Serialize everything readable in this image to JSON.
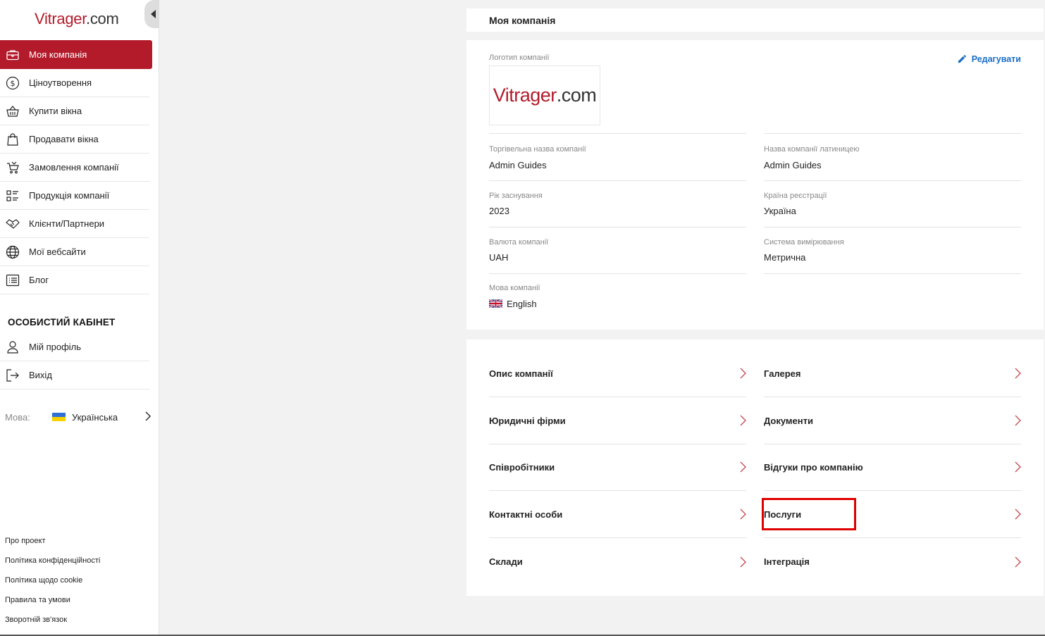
{
  "sidebar": {
    "logo": {
      "brand": "Vitrager",
      "domain": ".com"
    },
    "nav": [
      {
        "label": "Моя компанія",
        "icon": "briefcase-icon",
        "active": true
      },
      {
        "label": "Ціноутворення",
        "icon": "dollar-circle-icon"
      },
      {
        "label": "Купити вікна",
        "icon": "basket-icon"
      },
      {
        "label": "Продавати вікна",
        "icon": "shopping-bag-icon"
      },
      {
        "label": "Замовлення компанії",
        "icon": "cart-icon"
      },
      {
        "label": "Продукція компанії",
        "icon": "product-list-icon"
      },
      {
        "label": "Клієнти/Партнери",
        "icon": "handshake-icon"
      },
      {
        "label": "Мої вебсайти",
        "icon": "globe-icon"
      },
      {
        "label": "Блог",
        "icon": "blog-list-icon"
      }
    ],
    "personal_title": "ОСОБИСТИЙ КАБІНЕТ",
    "personal_nav": [
      {
        "label": "Мій профіль",
        "icon": "user-icon"
      },
      {
        "label": "Вихід",
        "icon": "logout-icon"
      }
    ],
    "language": {
      "label": "Мова:",
      "value": "Українська"
    },
    "footer_links": [
      "Про проект",
      "Політика конфіденційності",
      "Політика щодо cookie",
      "Правила та умови",
      "Зворотній зв'язок"
    ]
  },
  "main": {
    "title": "Моя компанія",
    "info": {
      "edit_label": "Редагувати",
      "logo_label": "Логотип компанії",
      "logo": {
        "brand": "Vitrager",
        "domain": ".com"
      },
      "fields": {
        "trade_name": {
          "label": "Торгівельна назва компанії",
          "value": "Admin Guides"
        },
        "latin_name": {
          "label": "Назва компанії латиницею",
          "value": "Admin Guides"
        },
        "founded": {
          "label": "Рік заснування",
          "value": "2023"
        },
        "country": {
          "label": "Країна реєстрації",
          "value": "Україна"
        },
        "currency": {
          "label": "Валюта компанії",
          "value": "UAH"
        },
        "measure": {
          "label": "Система вимірювання",
          "value": "Метрична"
        },
        "language": {
          "label": "Мова компанії",
          "value": "English"
        }
      }
    },
    "links_left": [
      "Опис компанії",
      "Юридичні фірми",
      "Співробітники",
      "Контактні особи",
      "Склади"
    ],
    "links_right": [
      "Галерея",
      "Документи",
      "Відгуки про компанію",
      "Послуги",
      "Інтеграція"
    ]
  },
  "colors": {
    "accent": "#b31b2b",
    "link": "#1a6ec7",
    "highlight": "#e00000"
  }
}
